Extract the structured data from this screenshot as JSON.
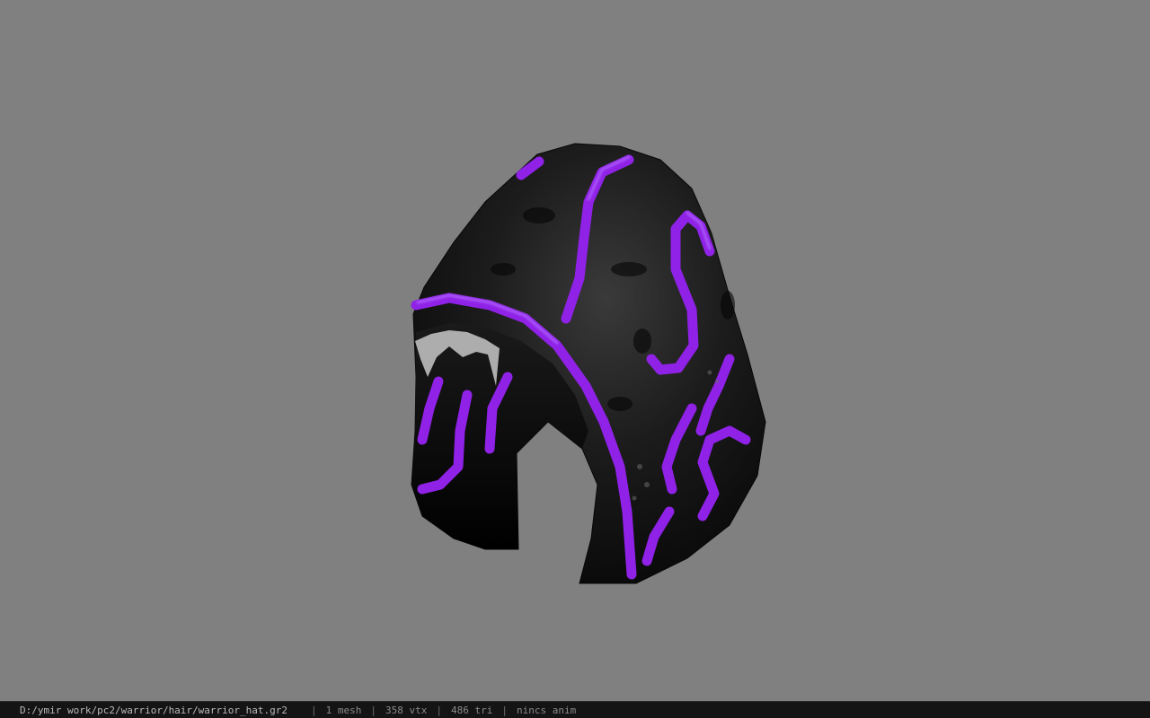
{
  "viewer": {
    "background_color": "#808080",
    "model": {
      "shell_color": "#121212",
      "trim_color": "#8f22e6",
      "icon": "hooded-hat-model"
    }
  },
  "status_bar": {
    "file_path": "D:/ymir work/pc2/warrior/hair/warrior_hat.gr2",
    "separator": "|",
    "mesh_count": "1 mesh",
    "vertex_count": "358 vtx",
    "triangle_count": "486 tri",
    "animation": "nincs anim"
  }
}
